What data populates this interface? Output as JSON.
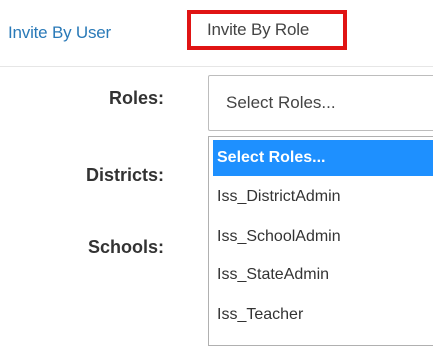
{
  "tabs": {
    "invite_by_user": "Invite By User",
    "invite_by_role": "Invite By Role"
  },
  "form": {
    "roles_label": "Roles:",
    "districts_label": "Districts:",
    "schools_label": "Schools:",
    "roles_select_value": "Select Roles..."
  },
  "dropdown": {
    "options": [
      "Select Roles...",
      "Iss_DistrictAdmin",
      "Iss_SchoolAdmin",
      "Iss_StateAdmin",
      "Iss_Teacher"
    ],
    "highlighted_option": "Select Roles..."
  },
  "colors": {
    "highlight_border": "#e01414",
    "link": "#2a7ab8",
    "selected_option_bg": "#1e90ff"
  }
}
